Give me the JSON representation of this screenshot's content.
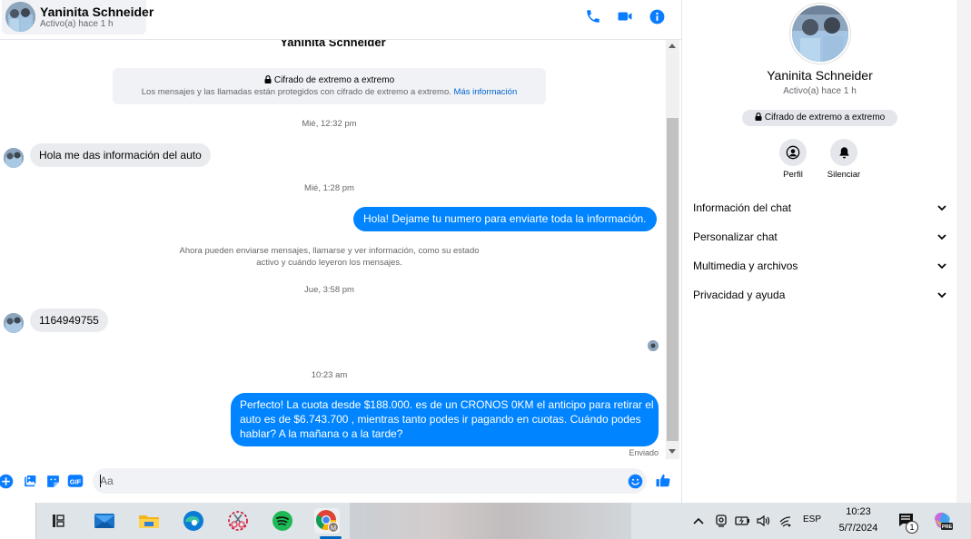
{
  "contact": {
    "name": "Yaninita Schneider",
    "status": "Activo(a) hace 1 h"
  },
  "encryption": {
    "title": "Cifrado de extremo a extremo",
    "body": "Los mensajes y las llamadas están protegidos con cifrado de extremo a extremo.",
    "link": "Más información"
  },
  "messages": [
    {
      "type": "timestamp",
      "text": "Mié, 12:32 pm"
    },
    {
      "type": "incoming",
      "text": "Hola me das información del auto"
    },
    {
      "type": "timestamp",
      "text": "Mié, 1:28 pm"
    },
    {
      "type": "outgoing",
      "text": "Hola! Dejame tu numero  para enviarte toda la información."
    },
    {
      "type": "system",
      "text_line1": "Ahora pueden enviarse mensajes, llamarse y ver información, como su estado",
      "text_line2": "activo y cuándo leyeron los mensajes."
    },
    {
      "type": "timestamp",
      "text": "Jue, 3:58 pm"
    },
    {
      "type": "incoming",
      "text": "1164949755"
    },
    {
      "type": "timestamp",
      "text": "10:23 am"
    },
    {
      "type": "outgoing",
      "line1": "Perfecto! La cuota desde $188.000. es de un CRONOS 0KM el anticipo para retirar el",
      "line2": "auto es de $6.743.700 , mientras tanto podes ir pagando en cuotas. Cuándo podes",
      "line3": "hablar? A la mañana o a la tarde?"
    }
  ],
  "delivery_status": "Enviado",
  "composer": {
    "placeholder": "Aa",
    "gif_label": "GIF"
  },
  "info_panel": {
    "name": "Yaninita Schneider",
    "status": "Activo(a) hace 1 h",
    "badge": "Cifrado de extremo a extremo",
    "actions": [
      {
        "label": "Perfil",
        "icon": "person-icon"
      },
      {
        "label": "Silenciar",
        "icon": "bell-icon"
      }
    ],
    "sections": [
      "Información del chat",
      "Personalizar chat",
      "Multimedia y archivos",
      "Privacidad y ayuda"
    ]
  },
  "colors": {
    "accent": "#0084ff",
    "icon_blue": "#0a7cff"
  },
  "taskbar": {
    "apps": [
      "task-view",
      "mail",
      "file-explorer",
      "edge",
      "snipping-tool",
      "spotify",
      "chrome"
    ],
    "chrome_profile_letter": "M",
    "language": "ESP",
    "time": "10:23",
    "date": "5/7/2024",
    "notification_count": "1",
    "copilot_label": "PRE"
  }
}
